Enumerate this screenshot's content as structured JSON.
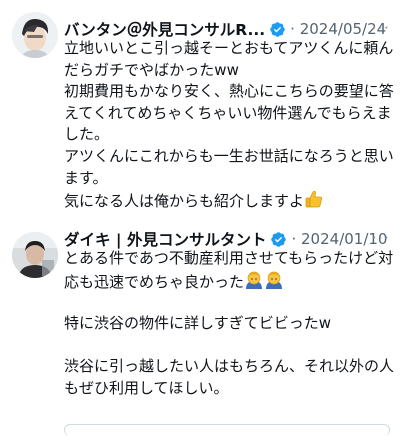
{
  "tweets": [
    {
      "author": "バンタン＠外見コンサルR...",
      "date": "2024/05/24",
      "more": "···",
      "lines": [
        "立地いいとこ引っ越そーとおもてアツくんに頼ん",
        "だらガチでやばかったww",
        "初期費用もかなり安く、熱心にこちらの要望に答",
        "えてくれてめちゃくちゃいい物件選んでもらえま",
        "した。",
        "アツくんにこれからも一生お世話になろうと思い",
        "ます。",
        "気になる人は俺からも紹介しますよ"
      ],
      "emoji": "thumbs-up"
    },
    {
      "author": "ダイキ | 外見コンサルタント",
      "date": "2024/01/10",
      "more": "···",
      "lines": [
        "とある件であつ不動産利用させてもらったけど対",
        "応も迅速でめちゃ良かった",
        "",
        "特に渋谷の物件に詳しすぎてビビったw",
        "",
        "渋谷に引っ越したい人はもちろん、それ以外の人",
        "もぜひ利用してほしい。"
      ],
      "emoji": "person-bowing"
    }
  ],
  "colors": {
    "verified": "#1d9bf0",
    "muted": "#536471",
    "text": "#0f1419"
  }
}
